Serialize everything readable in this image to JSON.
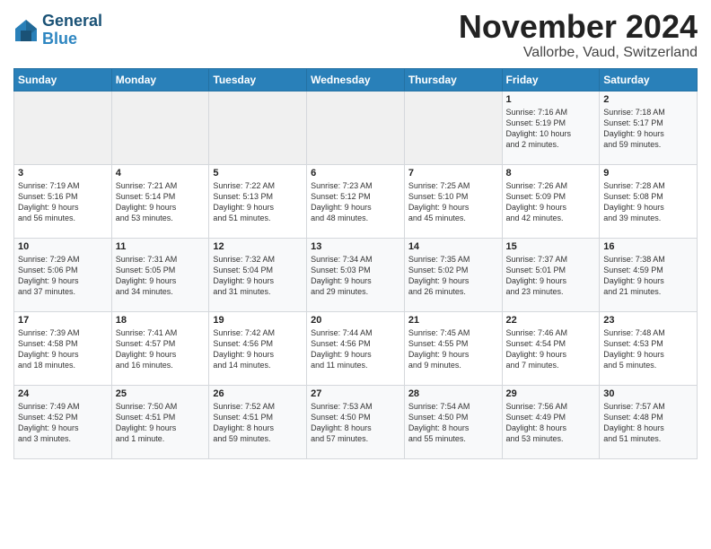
{
  "header": {
    "logo_line1": "General",
    "logo_line2": "Blue",
    "month_title": "November 2024",
    "location": "Vallorbe, Vaud, Switzerland"
  },
  "weekdays": [
    "Sunday",
    "Monday",
    "Tuesday",
    "Wednesday",
    "Thursday",
    "Friday",
    "Saturday"
  ],
  "weeks": [
    [
      {
        "day": "",
        "info": ""
      },
      {
        "day": "",
        "info": ""
      },
      {
        "day": "",
        "info": ""
      },
      {
        "day": "",
        "info": ""
      },
      {
        "day": "",
        "info": ""
      },
      {
        "day": "1",
        "info": "Sunrise: 7:16 AM\nSunset: 5:19 PM\nDaylight: 10 hours\nand 2 minutes."
      },
      {
        "day": "2",
        "info": "Sunrise: 7:18 AM\nSunset: 5:17 PM\nDaylight: 9 hours\nand 59 minutes."
      }
    ],
    [
      {
        "day": "3",
        "info": "Sunrise: 7:19 AM\nSunset: 5:16 PM\nDaylight: 9 hours\nand 56 minutes."
      },
      {
        "day": "4",
        "info": "Sunrise: 7:21 AM\nSunset: 5:14 PM\nDaylight: 9 hours\nand 53 minutes."
      },
      {
        "day": "5",
        "info": "Sunrise: 7:22 AM\nSunset: 5:13 PM\nDaylight: 9 hours\nand 51 minutes."
      },
      {
        "day": "6",
        "info": "Sunrise: 7:23 AM\nSunset: 5:12 PM\nDaylight: 9 hours\nand 48 minutes."
      },
      {
        "day": "7",
        "info": "Sunrise: 7:25 AM\nSunset: 5:10 PM\nDaylight: 9 hours\nand 45 minutes."
      },
      {
        "day": "8",
        "info": "Sunrise: 7:26 AM\nSunset: 5:09 PM\nDaylight: 9 hours\nand 42 minutes."
      },
      {
        "day": "9",
        "info": "Sunrise: 7:28 AM\nSunset: 5:08 PM\nDaylight: 9 hours\nand 39 minutes."
      }
    ],
    [
      {
        "day": "10",
        "info": "Sunrise: 7:29 AM\nSunset: 5:06 PM\nDaylight: 9 hours\nand 37 minutes."
      },
      {
        "day": "11",
        "info": "Sunrise: 7:31 AM\nSunset: 5:05 PM\nDaylight: 9 hours\nand 34 minutes."
      },
      {
        "day": "12",
        "info": "Sunrise: 7:32 AM\nSunset: 5:04 PM\nDaylight: 9 hours\nand 31 minutes."
      },
      {
        "day": "13",
        "info": "Sunrise: 7:34 AM\nSunset: 5:03 PM\nDaylight: 9 hours\nand 29 minutes."
      },
      {
        "day": "14",
        "info": "Sunrise: 7:35 AM\nSunset: 5:02 PM\nDaylight: 9 hours\nand 26 minutes."
      },
      {
        "day": "15",
        "info": "Sunrise: 7:37 AM\nSunset: 5:01 PM\nDaylight: 9 hours\nand 23 minutes."
      },
      {
        "day": "16",
        "info": "Sunrise: 7:38 AM\nSunset: 4:59 PM\nDaylight: 9 hours\nand 21 minutes."
      }
    ],
    [
      {
        "day": "17",
        "info": "Sunrise: 7:39 AM\nSunset: 4:58 PM\nDaylight: 9 hours\nand 18 minutes."
      },
      {
        "day": "18",
        "info": "Sunrise: 7:41 AM\nSunset: 4:57 PM\nDaylight: 9 hours\nand 16 minutes."
      },
      {
        "day": "19",
        "info": "Sunrise: 7:42 AM\nSunset: 4:56 PM\nDaylight: 9 hours\nand 14 minutes."
      },
      {
        "day": "20",
        "info": "Sunrise: 7:44 AM\nSunset: 4:56 PM\nDaylight: 9 hours\nand 11 minutes."
      },
      {
        "day": "21",
        "info": "Sunrise: 7:45 AM\nSunset: 4:55 PM\nDaylight: 9 hours\nand 9 minutes."
      },
      {
        "day": "22",
        "info": "Sunrise: 7:46 AM\nSunset: 4:54 PM\nDaylight: 9 hours\nand 7 minutes."
      },
      {
        "day": "23",
        "info": "Sunrise: 7:48 AM\nSunset: 4:53 PM\nDaylight: 9 hours\nand 5 minutes."
      }
    ],
    [
      {
        "day": "24",
        "info": "Sunrise: 7:49 AM\nSunset: 4:52 PM\nDaylight: 9 hours\nand 3 minutes."
      },
      {
        "day": "25",
        "info": "Sunrise: 7:50 AM\nSunset: 4:51 PM\nDaylight: 9 hours\nand 1 minute."
      },
      {
        "day": "26",
        "info": "Sunrise: 7:52 AM\nSunset: 4:51 PM\nDaylight: 8 hours\nand 59 minutes."
      },
      {
        "day": "27",
        "info": "Sunrise: 7:53 AM\nSunset: 4:50 PM\nDaylight: 8 hours\nand 57 minutes."
      },
      {
        "day": "28",
        "info": "Sunrise: 7:54 AM\nSunset: 4:50 PM\nDaylight: 8 hours\nand 55 minutes."
      },
      {
        "day": "29",
        "info": "Sunrise: 7:56 AM\nSunset: 4:49 PM\nDaylight: 8 hours\nand 53 minutes."
      },
      {
        "day": "30",
        "info": "Sunrise: 7:57 AM\nSunset: 4:48 PM\nDaylight: 8 hours\nand 51 minutes."
      }
    ]
  ]
}
